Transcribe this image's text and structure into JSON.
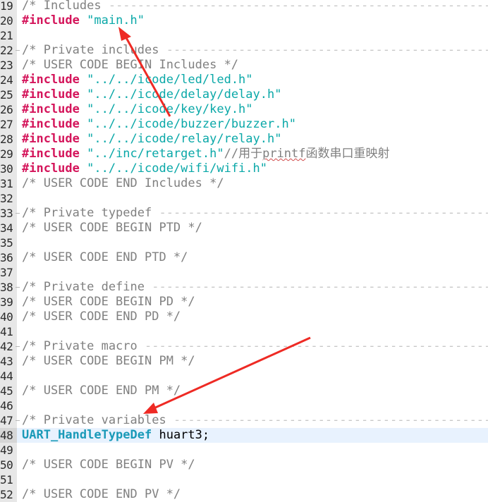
{
  "editor": {
    "lines": [
      {
        "num": "19",
        "fold": false,
        "tokens": [
          {
            "t": "/* Includes ",
            "c": "cmt"
          }
        ],
        "fill": true
      },
      {
        "num": "20",
        "tokens": [
          {
            "t": "#include ",
            "c": "kw"
          },
          {
            "t": "\"main.h\"",
            "c": "str"
          }
        ]
      },
      {
        "num": "21",
        "tokens": []
      },
      {
        "num": "22",
        "fold": true,
        "tokens": [
          {
            "t": "/* Private includes ",
            "c": "cmt"
          }
        ],
        "fill": true
      },
      {
        "num": "23",
        "tokens": [
          {
            "t": "/* USER CODE BEGIN Includes */",
            "c": "cmt"
          }
        ]
      },
      {
        "num": "24",
        "tokens": [
          {
            "t": "#include ",
            "c": "kw"
          },
          {
            "t": "\"../../icode/led/led.h\"",
            "c": "str"
          }
        ]
      },
      {
        "num": "25",
        "tokens": [
          {
            "t": "#include ",
            "c": "kw"
          },
          {
            "t": "\"../../icode/delay/delay.h\"",
            "c": "str"
          }
        ]
      },
      {
        "num": "26",
        "tokens": [
          {
            "t": "#include ",
            "c": "kw"
          },
          {
            "t": "\"../../icode/key/key.h\"",
            "c": "str"
          }
        ]
      },
      {
        "num": "27",
        "tokens": [
          {
            "t": "#include ",
            "c": "kw"
          },
          {
            "t": "\"../../icode/buzzer/buzzer.h\"",
            "c": "str"
          }
        ]
      },
      {
        "num": "28",
        "tokens": [
          {
            "t": "#include ",
            "c": "kw"
          },
          {
            "t": "\"../../icode/relay/relay.h\"",
            "c": "str"
          }
        ]
      },
      {
        "num": "29",
        "tokens": [
          {
            "t": "#include ",
            "c": "kw"
          },
          {
            "t": "\"../inc/retarget.h\"",
            "c": "str"
          },
          {
            "t": "//用于",
            "c": "cmt"
          },
          {
            "t": "printf",
            "c": "cmt ime"
          },
          {
            "t": "函数串口重映射",
            "c": "cmt"
          }
        ]
      },
      {
        "num": "30",
        "tokens": [
          {
            "t": "#include ",
            "c": "kw"
          },
          {
            "t": "\"../../icode/wifi/wifi.h\"",
            "c": "str"
          }
        ]
      },
      {
        "num": "31",
        "tokens": [
          {
            "t": "/* USER CODE END Includes */",
            "c": "cmt"
          }
        ]
      },
      {
        "num": "32",
        "tokens": []
      },
      {
        "num": "33",
        "fold": true,
        "tokens": [
          {
            "t": "/* Private typedef ",
            "c": "cmt"
          }
        ],
        "fill": true
      },
      {
        "num": "34",
        "tokens": [
          {
            "t": "/* USER CODE BEGIN PTD */",
            "c": "cmt"
          }
        ]
      },
      {
        "num": "35",
        "tokens": []
      },
      {
        "num": "36",
        "tokens": [
          {
            "t": "/* USER CODE END PTD */",
            "c": "cmt"
          }
        ]
      },
      {
        "num": "37",
        "tokens": []
      },
      {
        "num": "38",
        "fold": true,
        "tokens": [
          {
            "t": "/* Private define ",
            "c": "cmt"
          }
        ],
        "fill": true
      },
      {
        "num": "39",
        "tokens": [
          {
            "t": "/* USER CODE BEGIN PD */",
            "c": "cmt"
          }
        ]
      },
      {
        "num": "40",
        "tokens": [
          {
            "t": "/* USER CODE END PD */",
            "c": "cmt"
          }
        ]
      },
      {
        "num": "41",
        "tokens": []
      },
      {
        "num": "42",
        "fold": true,
        "tokens": [
          {
            "t": "/* Private macro ",
            "c": "cmt"
          }
        ],
        "fill": true
      },
      {
        "num": "43",
        "tokens": [
          {
            "t": "/* USER CODE BEGIN PM */",
            "c": "cmt"
          }
        ]
      },
      {
        "num": "44",
        "tokens": []
      },
      {
        "num": "45",
        "tokens": [
          {
            "t": "/* USER CODE END PM */",
            "c": "cmt"
          }
        ]
      },
      {
        "num": "46",
        "tokens": []
      },
      {
        "num": "47",
        "fold": true,
        "tokens": [
          {
            "t": "/* Private variables ",
            "c": "cmt"
          }
        ],
        "fill": true
      },
      {
        "num": "48",
        "current": true,
        "tokens": [
          {
            "t": "UART_HandleTypeDef",
            "c": "type"
          },
          {
            "t": " huart3;",
            "c": "plain"
          }
        ]
      },
      {
        "num": "49",
        "tokens": []
      },
      {
        "num": "50",
        "tokens": [
          {
            "t": "/* USER CODE BEGIN PV */",
            "c": "cmt"
          }
        ]
      },
      {
        "num": "51",
        "tokens": []
      },
      {
        "num": "52",
        "tokens": [
          {
            "t": "/* USER CODE END PV */",
            "c": "cmt"
          }
        ]
      }
    ],
    "fill_text": "------------------------------------------------------------------",
    "colors": {
      "keyword": "#d4145a",
      "string": "#0aa8a8",
      "comment": "#808080",
      "type": "#1a9ab8",
      "current_line": "#e8f2fe",
      "gutter": "#e7e7e7",
      "annotation_arrow": "#ee2a24"
    }
  },
  "annotations": [
    {
      "kind": "arrow",
      "color": "#ee2a24",
      "points_to": "main.h include"
    },
    {
      "kind": "arrow",
      "color": "#ee2a24",
      "points_to": "Private variables section"
    }
  ]
}
